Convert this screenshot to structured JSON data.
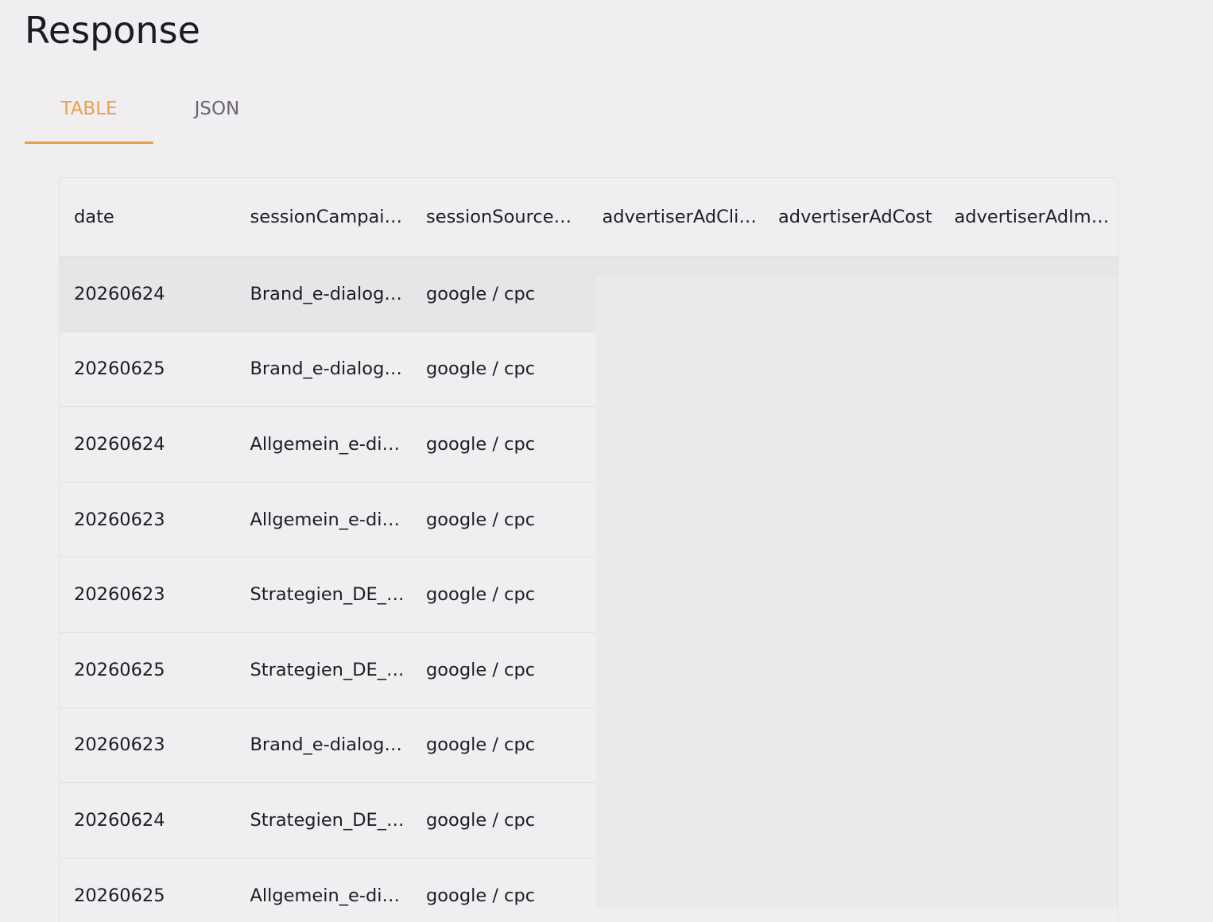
{
  "page": {
    "title": "Response"
  },
  "tabs": [
    {
      "label": "TABLE",
      "active": true
    },
    {
      "label": "JSON",
      "active": false
    }
  ],
  "table": {
    "columns": [
      "date",
      "sessionCampai…",
      "sessionSource…",
      "advertiserAdClic…",
      "advertiserAdCost",
      "advertiserAdImp…"
    ],
    "rows": [
      [
        "20260624",
        "Brand_e-dialog…",
        "google / cpc"
      ],
      [
        "20260625",
        "Brand_e-dialog…",
        "google / cpc"
      ],
      [
        "20260624",
        "Allgemein_e-di…",
        "google / cpc"
      ],
      [
        "20260623",
        "Allgemein_e-di…",
        "google / cpc"
      ],
      [
        "20260623",
        "Strategien_DE_…",
        "google / cpc"
      ],
      [
        "20260625",
        "Strategien_DE_…",
        "google / cpc"
      ],
      [
        "20260623",
        "Brand_e-dialog…",
        "google / cpc"
      ],
      [
        "20260624",
        "Strategien_DE_…",
        "google / cpc"
      ],
      [
        "20260625",
        "Allgemein_e-di…",
        "google / cpc"
      ]
    ]
  },
  "colors": {
    "accent": "#e9a04a",
    "background": "#f0eef1",
    "hover_row": "#e7e5e8",
    "loading_overlay": "#ebe9ec"
  }
}
